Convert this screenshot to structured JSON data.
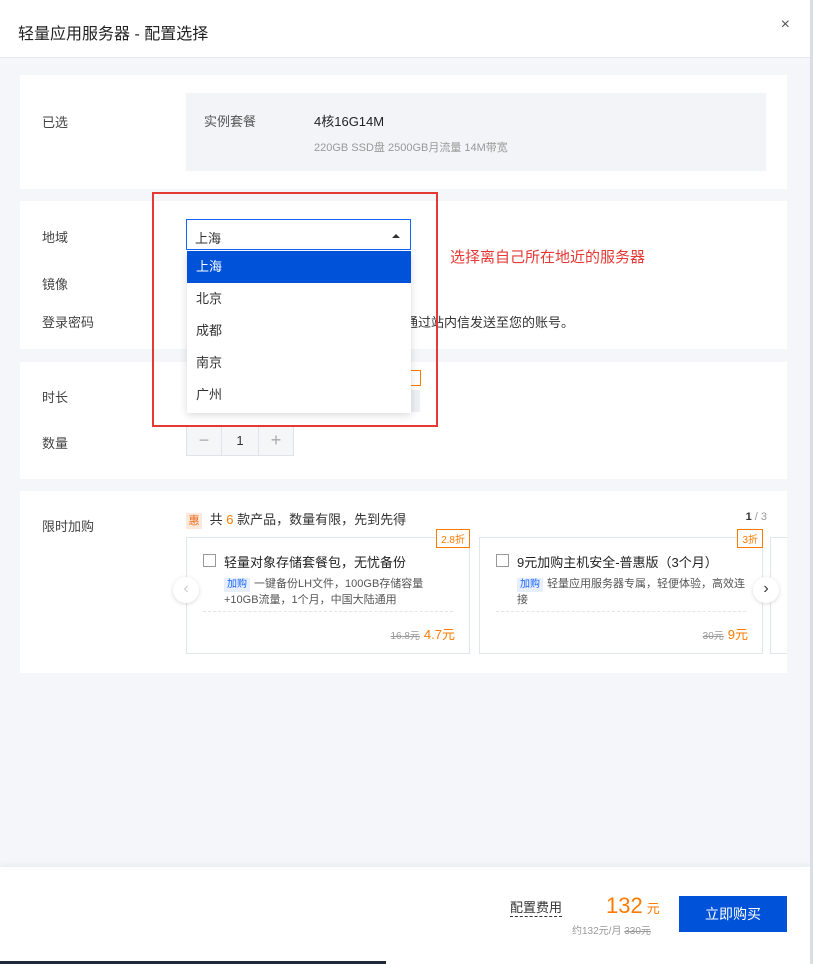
{
  "dialog": {
    "title": "轻量应用服务器 - 配置选择",
    "close_glyph": "×"
  },
  "selected": {
    "label": "已选",
    "key": "实例套餐",
    "value": "4核16G14M",
    "sub": "220GB SSD盘 2500GB月流量 14M带宽"
  },
  "region": {
    "label": "地域",
    "selected": "上海",
    "options": [
      "上海",
      "北京",
      "成都",
      "南京",
      "广州"
    ]
  },
  "image": {
    "label": "镜像"
  },
  "password": {
    "label": "登录密码",
    "hint_visible": "后通过站内信发送至您的账号。"
  },
  "duration": {
    "label": "时长"
  },
  "quantity": {
    "label": "数量",
    "minus": "−",
    "value": "1",
    "plus": "+"
  },
  "addon": {
    "label": "限时加购",
    "tag": "惠",
    "promo_prefix": "共",
    "promo_count": "6",
    "promo_suffix": "款产品，数量有限，先到先得",
    "pager_current": "1",
    "pager_sep": " / ",
    "pager_total": "3",
    "prev_glyph": "‹",
    "next_glyph": "›",
    "cards": [
      {
        "discount": "2.8折",
        "name": "轻量对象存储套餐包，无忧备份",
        "badge": "加购",
        "desc": "一键备份LH文件，100GB存储容量+10GB流量，1个月，中国大陆通用",
        "old_price": "16.8元",
        "price": "4.7元"
      },
      {
        "discount": "3折",
        "name": "9元加购主机安全-普惠版（3个月）",
        "badge": "加购",
        "desc": "轻量应用服务器专属，轻便体验，高效连接",
        "old_price": "30元",
        "price": "9元"
      }
    ]
  },
  "annotation": {
    "text": "选择离自己所在地近的服务器",
    "color": "#e53935"
  },
  "footer": {
    "fee_label": "配置费用",
    "amount": "132",
    "unit": "元",
    "monthly": "约132元/月",
    "old_price": "330元",
    "buy_label": "立即购买"
  },
  "colors": {
    "primary": "#0052d9",
    "accent": "#ff7a00",
    "annotation": "#e53935"
  }
}
